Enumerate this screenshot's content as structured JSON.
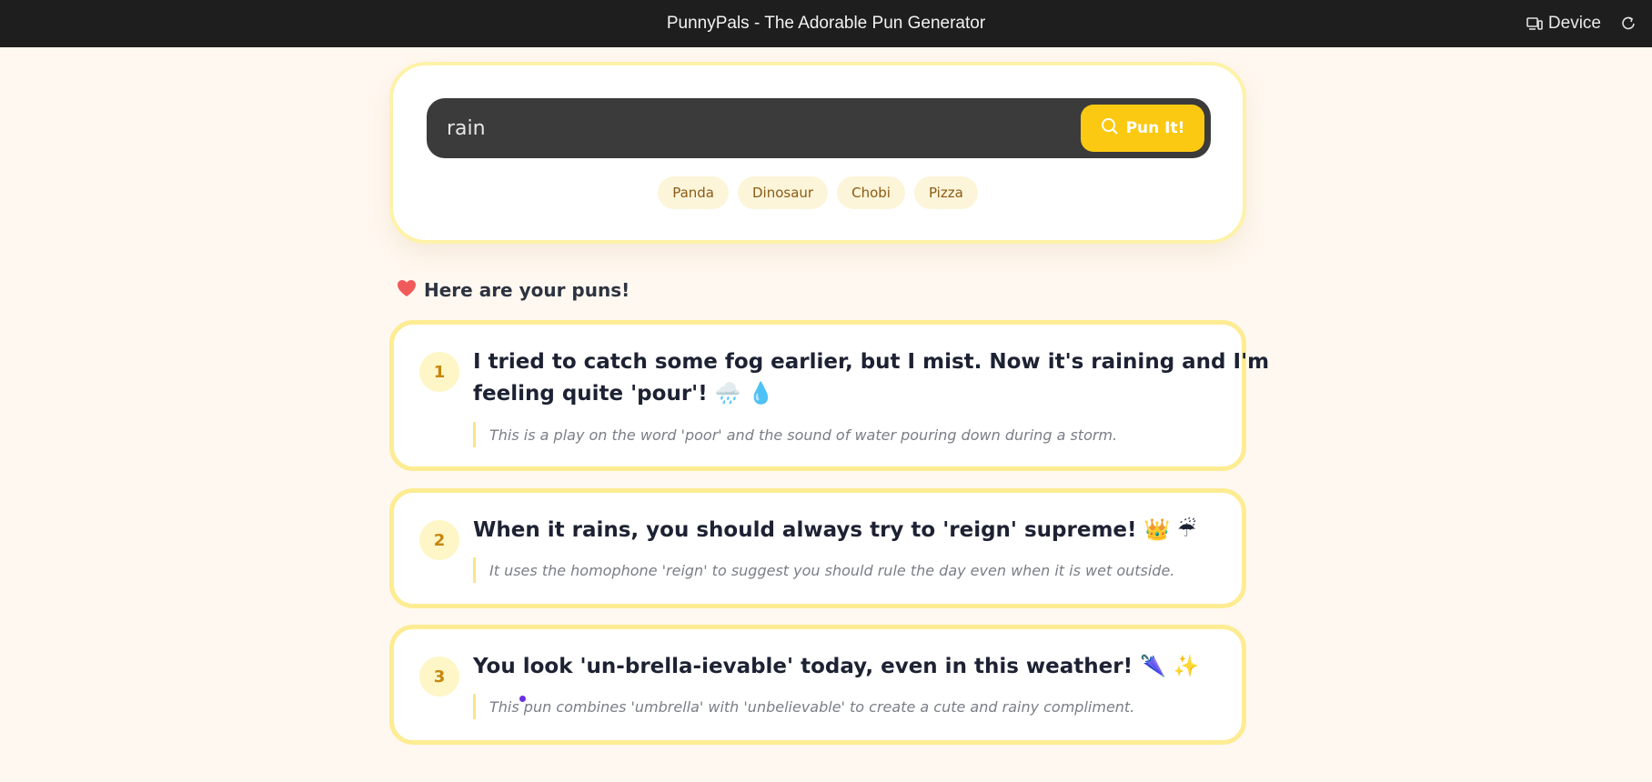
{
  "window": {
    "title": "PunnyPals - The Adorable Pun Generator",
    "device_label": "Device"
  },
  "search": {
    "value": "rain",
    "placeholder": "",
    "button_label": "Pun It!"
  },
  "suggestions": [
    "Panda",
    "Dinosaur",
    "Chobi",
    "Pizza"
  ],
  "results": {
    "heading": "Here are your puns!",
    "puns": [
      {
        "number": "1",
        "line1": "I tried to catch some fog earlier, but I mist. Now it's raining and I'm",
        "line2": "feeling quite 'pour'! 🌧️ 💧",
        "explanation": "This is a play on the word 'poor' and the sound of water pouring down during a storm."
      },
      {
        "number": "2",
        "line1": "When it rains, you should always try to 'reign' supreme! 👑 ☔",
        "explanation": "It uses the homophone 'reign' to suggest you should rule the day even when it is wet outside."
      },
      {
        "number": "3",
        "line1": "You look 'un-brella-ievable' today, even in this weather! 🌂 ✨",
        "explanation": "This pun combines 'umbrella' with 'unbelievable' to create a cute and rainy compliment."
      }
    ]
  },
  "colors": {
    "background": "#fff8f0",
    "topbar": "#1e1e1e",
    "accent_yellow": "#fbc912",
    "card_border": "#fdec93",
    "heart": "#f05a5a"
  },
  "icons": {
    "device": "device-icon",
    "refresh": "refresh-icon",
    "search": "search-icon",
    "heart": "heart-icon"
  }
}
